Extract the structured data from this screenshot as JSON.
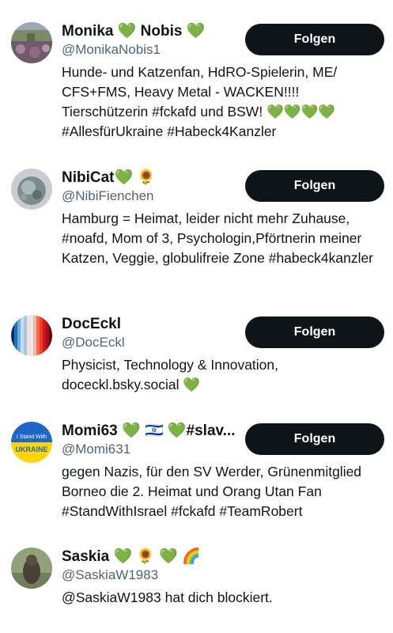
{
  "follow_label": "Folgen",
  "users": [
    {
      "name": "Monika 💚 Nobis 💚",
      "handle": "@MonikaNobis1",
      "bio": "Hunde- und Katzenfan, HdRO-Spielerin, ME/ CFS+FMS, Heavy Metal - WACKEN!!!! Tierschützerin #fckafd und BSW! 💚💚💚💚 #AllesfürUkraine #Habeck4Kanzler",
      "avatar": "avatar-landscape-field"
    },
    {
      "name": "NibiCat💚 🌻",
      "handle": "@NibiFienchen",
      "bio": "Hamburg = Heimat, leider nicht mehr Zuhause, #noafd, Mom of 3, Psychologin,Pförtnerin meiner Katzen, Veggie, globulifreie Zone #habeck4kanzler",
      "avatar": "avatar-crystal-ball"
    },
    {
      "name": "DocEckl",
      "handle": "@DocEckl",
      "bio": "Physicist, Technology & Innovation, doceckl.bsky.social 💚",
      "avatar": "avatar-warming-stripes"
    },
    {
      "name": "Momi63 💚 🇮🇱 💚#slav...",
      "handle": "@Momi631",
      "bio": "gegen Nazis, für den SV Werder, Grünenmitglied Borneo die 2. Heimat und Orang Utan Fan #StandWithIsrael #fckafd #TeamRobert",
      "avatar": "avatar-stand-with-ukraine",
      "avatar_text_top": "I Stand With",
      "avatar_text_bottom": "UKRAINE"
    },
    {
      "name": "Saskia 💚 🌻 💚 🌈",
      "handle": "@SaskiaW1983",
      "bio": "@SaskiaW1983 hat dich blockiert.",
      "avatar": "avatar-dog-photo"
    }
  ]
}
